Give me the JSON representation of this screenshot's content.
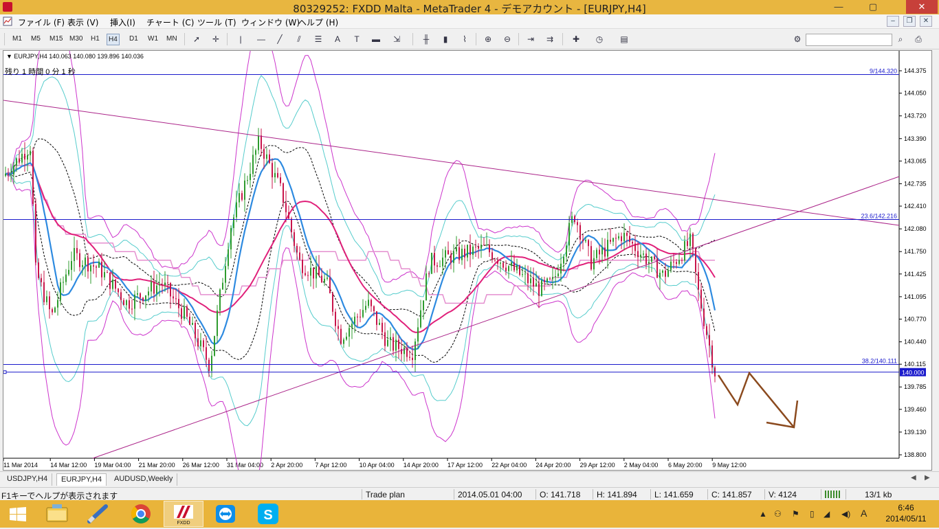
{
  "window": {
    "title": "80329252: FXDD Malta - MetaTrader 4 - デモアカウント - [EURJPY,H4]",
    "minimize": "—",
    "maximize": "▢",
    "close": "✕"
  },
  "menu": {
    "items": [
      "ファイル (F)",
      "表示 (V)",
      "挿入(I)",
      "チャート (C)",
      "ツール (T)",
      "ウィンドウ (W)",
      "ヘルプ (H)"
    ],
    "mdi_min": "–",
    "mdi_restore": "❐",
    "mdi_close": "✕"
  },
  "toolbar": {
    "timeframes": [
      "M1",
      "M5",
      "M15",
      "M30",
      "H1",
      "H4",
      "D1",
      "W1",
      "MN"
    ],
    "active_timeframe": "H4",
    "tool_icons": [
      "cursor-icon",
      "crosshair-icon",
      "vertical-line-icon",
      "horizontal-line-icon",
      "trendline-icon",
      "equidistant-channel-icon",
      "fibonacci-icon",
      "text-icon",
      "text-label-icon",
      "rectangle-icon",
      "arrows-icon",
      "bar-chart-icon",
      "candlestick-icon",
      "line-chart-icon",
      "zoom-in-icon",
      "zoom-out-icon",
      "chart-shift-icon",
      "autoscroll-icon",
      "indicators-icon",
      "periods-icon",
      "templates-icon",
      "settings-icon",
      "search-icon",
      "account-icon"
    ]
  },
  "chart": {
    "info_line": "▼ EURJPY,H4  140.063 140.080 139.896 140.036",
    "timer": "残り 1 時間 0 分 1 秒",
    "price_levels": [
      {
        "label": "144.375",
        "value": 144.375
      },
      {
        "label": "144.050",
        "value": 144.05
      },
      {
        "label": "143.720",
        "value": 143.72
      },
      {
        "label": "143.390",
        "value": 143.39
      },
      {
        "label": "143.065",
        "value": 143.065
      },
      {
        "label": "142.735",
        "value": 142.735
      },
      {
        "label": "142.410",
        "value": 142.41
      },
      {
        "label": "142.080",
        "value": 142.08
      },
      {
        "label": "141.750",
        "value": 141.75
      },
      {
        "label": "141.425",
        "value": 141.425
      },
      {
        "label": "141.095",
        "value": 141.095
      },
      {
        "label": "140.770",
        "value": 140.77
      },
      {
        "label": "140.440",
        "value": 140.44
      },
      {
        "label": "140.115",
        "value": 140.115
      },
      {
        "label": "139.785",
        "value": 139.785
      },
      {
        "label": "139.460",
        "value": 139.46
      },
      {
        "label": "139.130",
        "value": 139.13
      },
      {
        "label": "138.800",
        "value": 138.8
      }
    ],
    "time_labels": [
      "11 Mar 2014",
      "14 Mar 12:00",
      "19 Mar 04:00",
      "21 Mar 20:00",
      "26 Mar 12:00",
      "31 Mar 04:00",
      "2 Apr 20:00",
      "7 Apr 12:00",
      "10 Apr 04:00",
      "14 Apr 20:00",
      "17 Apr 12:00",
      "22 Apr 04:00",
      "24 Apr 20:00",
      "29 Apr 12:00",
      "2 May 04:00",
      "6 May 20:00",
      "9 May 12:00"
    ],
    "fib_levels": [
      {
        "label": "9/144.320",
        "value": 144.32
      },
      {
        "label": "23.6/142.216",
        "value": 142.216
      },
      {
        "label": "38.2/140.111",
        "value": 140.111
      }
    ],
    "current_price": {
      "label": "140.000",
      "value": 140.0
    },
    "colors": {
      "bull": "#2e9b2e",
      "bear": "#c8144a",
      "ma_fast": "#2d8ae0",
      "ma_slow": "#e0207a",
      "bb_outer": "#cc33cc",
      "bb_inner": "#55cccc",
      "fib": "#1a1acc",
      "trend": "#aa2288",
      "forecast": "#8b4a1e",
      "pink_line": "#e48fcf"
    }
  },
  "tabs": {
    "items": [
      "USDJPY,H4",
      "EURJPY,H4",
      "AUDUSD,Weekly"
    ],
    "active": "EURJPY,H4"
  },
  "status": {
    "help": "F1キーでヘルプが表示されます",
    "profile": "Trade plan",
    "datetime": "2014.05.01 04:00",
    "open": "O: 141.718",
    "high": "H: 141.894",
    "low": "L: 141.659",
    "close": "C: 141.857",
    "volume": "V: 4124",
    "traffic": "13/1 kb"
  },
  "taskbar": {
    "apps": [
      "start-icon",
      "file-explorer-icon",
      "pen-tool-icon",
      "chrome-icon",
      "fxdd-icon",
      "teamviewer-icon",
      "skype-icon"
    ],
    "active_app": "fxdd-icon",
    "ime": "A",
    "time": "6:46",
    "date": "2014/05/11"
  }
}
